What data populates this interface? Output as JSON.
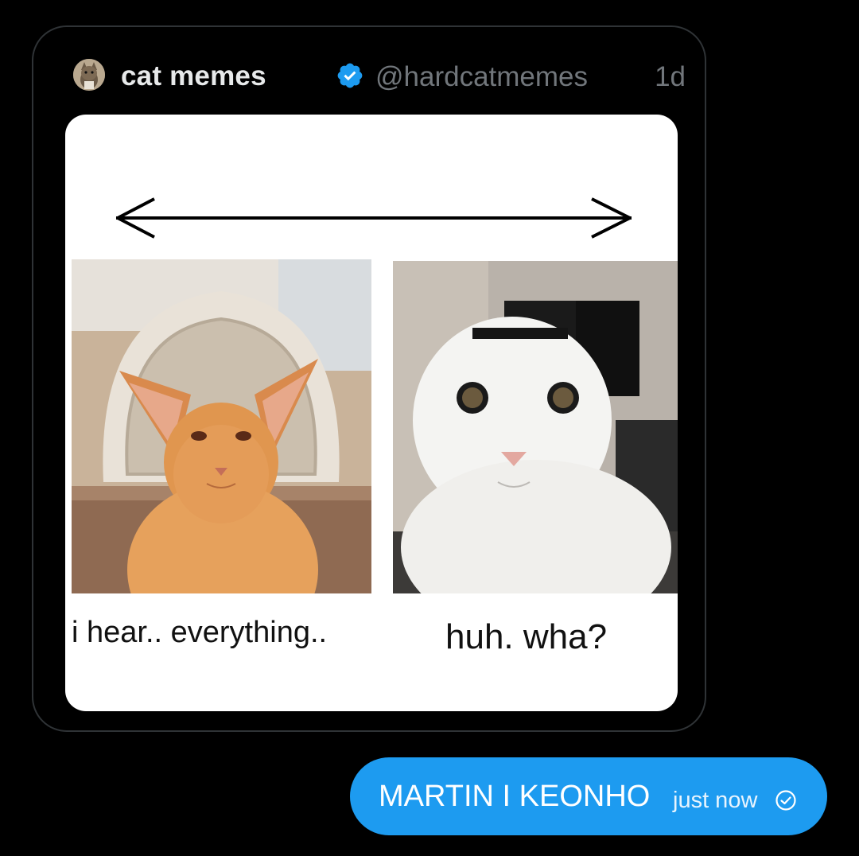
{
  "tweet": {
    "author_name": "cat memes",
    "handle": "@hardcatmemes",
    "timestamp": "1d",
    "verified": true,
    "media": {
      "caption_left": "i hear.. everything..",
      "caption_right": "huh. wha?"
    }
  },
  "message": {
    "text": "MARTIN I KEONHO",
    "time": "just now",
    "status_icon": "check-circle-icon"
  },
  "colors": {
    "background": "#000000",
    "card_border": "#2f3336",
    "verified_blue": "#1d9bf0",
    "bubble_blue": "#1d9bf0",
    "muted_text": "#71767b"
  }
}
